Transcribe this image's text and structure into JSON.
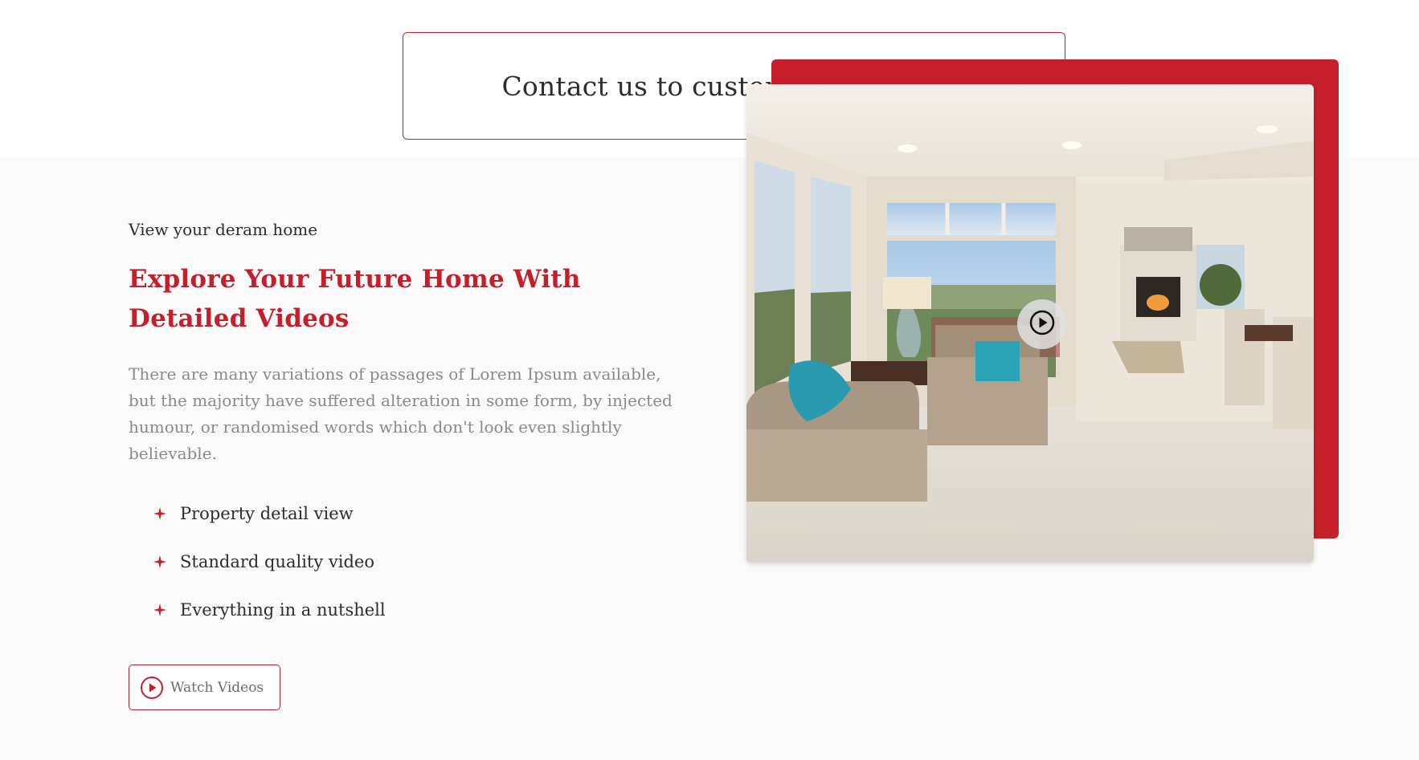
{
  "cta": {
    "label": "Contact us to customize your plan"
  },
  "video_section": {
    "eyebrow": "View your deram home",
    "headline": "Explore Your Future Home With Detailed Videos",
    "description": "There are many variations of passages of Lorem Ipsum available, but the majority have suffered alteration in some form, by injected humour, or randomised words which don't look even slightly believable.",
    "features": [
      {
        "label": "Property detail view"
      },
      {
        "label": "Standard quality video"
      },
      {
        "label": "Everything in a nutshell"
      }
    ],
    "watch_button_label": "Watch Videos",
    "media": {
      "image_icon": "living-room-photo",
      "play_icon": "play-circle-icon"
    }
  },
  "colors": {
    "accent": "#c51f2b",
    "section_bg": "#fafafa",
    "body_text": "#8a8a8a",
    "heading_text": "#2d2d2d"
  }
}
